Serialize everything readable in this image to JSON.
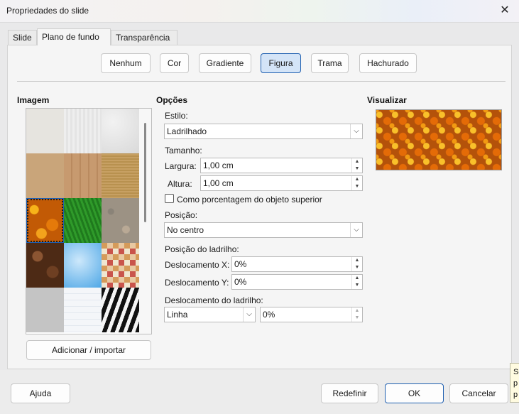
{
  "window": {
    "title": "Propriedades do slide",
    "close_icon": "close-icon"
  },
  "tabs": [
    {
      "label": "Slide"
    },
    {
      "label": "Plano de fundo",
      "active": true
    },
    {
      "label": "Transparência"
    }
  ],
  "fill_types": {
    "none": "Nenhum",
    "color": "Cor",
    "gradient": "Gradiente",
    "image": "Figura",
    "pattern": "Trama",
    "hatch": "Hachurado",
    "selected": "Figura"
  },
  "image_section": {
    "title": "Imagem",
    "add_button": "Adicionar / importar",
    "swatches": [
      "Textura clara",
      "Papel",
      "Gesso",
      "Areia",
      "Madeira",
      "Papelão",
      "Folhas de outono",
      "Grama",
      "Cascalho",
      "Café",
      "Céu",
      "Mosaico",
      "Concreto",
      "Papel quadriculado",
      "Zebra"
    ],
    "selected_index": 6
  },
  "options": {
    "title": "Opções",
    "style_label": "Estilo:",
    "style_value": "Ladrilhado",
    "size_label": "Tamanho:",
    "width_label": "Largura:",
    "width_value": "1,00 cm",
    "height_label": "Altura:",
    "height_value": "1,00 cm",
    "relative_checkbox": "Como porcentagem do objeto superior",
    "relative_checked": false,
    "position_label": "Posição:",
    "position_value": "No centro",
    "tile_position_label": "Posição do ladrilho:",
    "offset_x_label": "Deslocamento X:",
    "offset_x_value": "0%",
    "offset_y_label": "Deslocamento Y:",
    "offset_y_value": "0%",
    "tile_offset_label": "Deslocamento do ladrilho:",
    "tile_offset_mode": "Linha",
    "tile_offset_value": "0%"
  },
  "preview": {
    "title": "Visualizar"
  },
  "footer": {
    "help": "Ajuda",
    "reset": "Redefinir",
    "ok": "OK",
    "cancel": "Cancelar"
  },
  "tooltip": {
    "lines": [
      "Se",
      "p",
      "p"
    ]
  }
}
